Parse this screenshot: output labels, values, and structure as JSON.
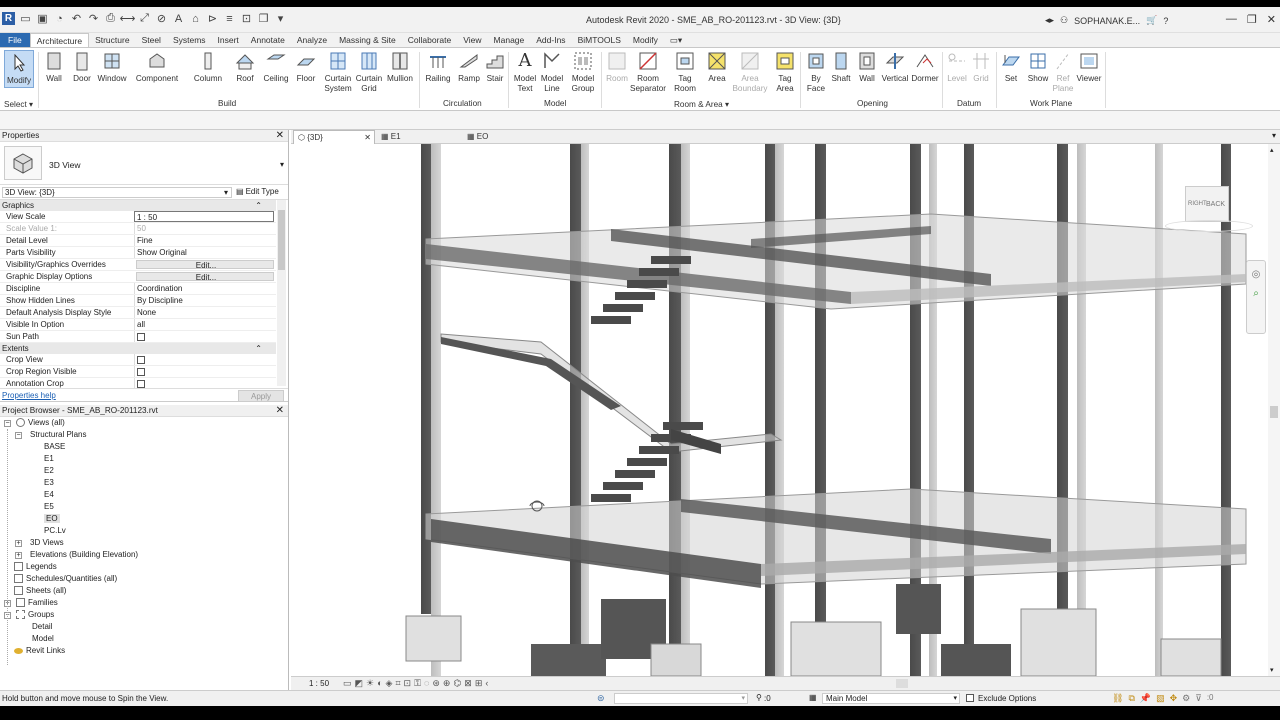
{
  "title_bar": {
    "window_title": "Autodesk Revit 2020 - SME_AB_RO-201123.rvt - 3D View: {3D}",
    "user_name": "SOPHANAK.E...",
    "logo_letter": "R"
  },
  "tabs": [
    {
      "label": "File"
    },
    {
      "label": "Architecture"
    },
    {
      "label": "Structure"
    },
    {
      "label": "Steel"
    },
    {
      "label": "Systems"
    },
    {
      "label": "Insert"
    },
    {
      "label": "Annotate"
    },
    {
      "label": "Analyze"
    },
    {
      "label": "Massing & Site"
    },
    {
      "label": "Collaborate"
    },
    {
      "label": "View"
    },
    {
      "label": "Manage"
    },
    {
      "label": "Add-Ins"
    },
    {
      "label": "BiMTOOLS"
    },
    {
      "label": "Modify"
    }
  ],
  "ribbon": {
    "buttons": {
      "modify": "Modify",
      "wall": "Wall",
      "door": "Door",
      "window": "Window",
      "component": "Component",
      "column": "Column",
      "roof": "Roof",
      "ceiling": "Ceiling",
      "floor": "Floor",
      "curtain_system_1": "Curtain",
      "curtain_system_2": "System",
      "curtain_grid_1": "Curtain",
      "curtain_grid_2": "Grid",
      "mullion": "Mullion",
      "railing": "Railing",
      "ramp": "Ramp",
      "stair": "Stair",
      "model_text_1": "Model",
      "model_text_2": "Text",
      "model_line_1": "Model",
      "model_line_2": "Line",
      "model_group_1": "Model",
      "model_group_2": "Group",
      "room": "Room",
      "room_sep_1": "Room",
      "room_sep_2": "Separator",
      "tag_room_1": "Tag",
      "tag_room_2": "Room",
      "area": "Area",
      "area_boundary_1": "Area",
      "area_boundary_2": "Boundary",
      "tag_area_1": "Tag",
      "tag_area_2": "Area",
      "by_face_1": "By",
      "by_face_2": "Face",
      "shaft": "Shaft",
      "opening_wall": "Wall",
      "vertical": "Vertical",
      "dormer": "Dormer",
      "level": "Level",
      "grid": "Grid",
      "set": "Set",
      "show": "Show",
      "ref_plane_1": "Ref",
      "ref_plane_2": "Plane",
      "viewer": "Viewer"
    },
    "panels": {
      "select": "Select",
      "build": "Build",
      "circulation": "Circulation",
      "model": "Model",
      "room_area": "Room & Area",
      "opening": "Opening",
      "datum": "Datum",
      "work_plane": "Work Plane"
    }
  },
  "properties": {
    "header": "Properties",
    "type_name": "3D View",
    "selector": "3D View: {3D}",
    "edit_type": "Edit Type",
    "section_graphics": "Graphics",
    "section_extents": "Extents",
    "rows": [
      {
        "k": "View Scale",
        "v": "1 : 50"
      },
      {
        "k": "Scale Value    1:",
        "v": "50"
      },
      {
        "k": "Detail Level",
        "v": "Fine"
      },
      {
        "k": "Parts Visibility",
        "v": "Show Original"
      },
      {
        "k": "Visibility/Graphics Overrides",
        "v": "Edit..."
      },
      {
        "k": "Graphic Display Options",
        "v": "Edit..."
      },
      {
        "k": "Discipline",
        "v": "Coordination"
      },
      {
        "k": "Show Hidden Lines",
        "v": "By Discipline"
      },
      {
        "k": "Default Analysis Display Style",
        "v": "None"
      },
      {
        "k": "Visible In Option",
        "v": "all"
      },
      {
        "k": "Sun Path",
        "v": ""
      }
    ],
    "extents_rows": [
      {
        "k": "Crop View",
        "v": ""
      },
      {
        "k": "Crop Region Visible",
        "v": ""
      },
      {
        "k": "Annotation Crop",
        "v": ""
      }
    ],
    "help_link": "Properties help",
    "apply": "Apply"
  },
  "project_browser": {
    "header": "Project Browser - SME_AB_RO-201123.rvt",
    "items": [
      {
        "label": "Views (all)"
      },
      {
        "label": "Structural Plans"
      },
      {
        "label": "BASE"
      },
      {
        "label": "E1"
      },
      {
        "label": "E2"
      },
      {
        "label": "E3"
      },
      {
        "label": "E4"
      },
      {
        "label": "E5"
      },
      {
        "label": "EO"
      },
      {
        "label": "PC.Lv"
      },
      {
        "label": "3D Views"
      },
      {
        "label": "Elevations (Building Elevation)"
      },
      {
        "label": "Legends"
      },
      {
        "label": "Schedules/Quantities (all)"
      },
      {
        "label": "Sheets (all)"
      },
      {
        "label": "Families"
      },
      {
        "label": "Groups"
      },
      {
        "label": "Detail"
      },
      {
        "label": "Model"
      },
      {
        "label": "Revit Links"
      }
    ]
  },
  "view_tabs": [
    {
      "label": "{3D}"
    },
    {
      "label": "E1"
    },
    {
      "label": "EO"
    }
  ],
  "viewcube": {
    "face_left": "RIGHT",
    "face_back": "BACK"
  },
  "view_control": {
    "scale": "1 : 50"
  },
  "status": {
    "message": "Hold button and move mouse to Spin the View.",
    "count": ":0",
    "model": "Main Model",
    "exclude_options": "Exclude Options"
  }
}
